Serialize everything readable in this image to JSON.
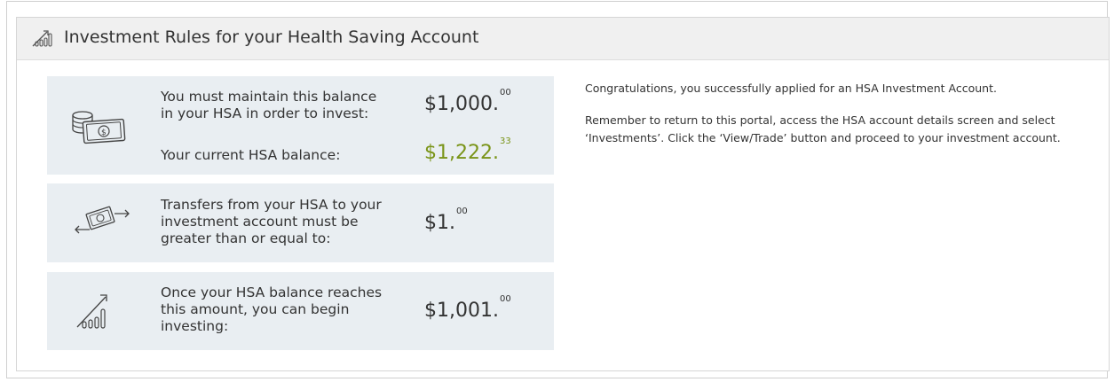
{
  "header": {
    "title": "Investment Rules for your Health Saving Account",
    "icon": "chart-growth-icon"
  },
  "rules": {
    "minimum": {
      "icon": "money-icon",
      "label_line1": "You must maintain this balance",
      "label_line2": "in your HSA in order to invest:",
      "amount_main": "$1,000.",
      "amount_cents": "00",
      "current_label": "Your current HSA balance:",
      "current_main": "$1,222.",
      "current_cents": "33",
      "current_color": "#7a9418"
    },
    "transfer": {
      "icon": "transfer-money-icon",
      "label_line1": "Transfers from your HSA to your",
      "label_line2": "investment account must be",
      "label_line3": "greater than or equal to:",
      "amount_main": "$1.",
      "amount_cents": "00"
    },
    "threshold": {
      "icon": "chart-growth-icon",
      "label_line1": "Once your HSA balance reaches",
      "label_line2": "this amount, you can begin",
      "label_line3": "investing:",
      "amount_main": "$1,001.",
      "amount_cents": "00"
    }
  },
  "message": {
    "line1": "Congratulations, you successfully applied for an HSA Investment Account.",
    "line2": "Remember to return to this portal, access the HSA account details screen and select",
    "line3": "‘Investments’. Click the ‘View/Trade’ button and proceed to your investment account."
  }
}
